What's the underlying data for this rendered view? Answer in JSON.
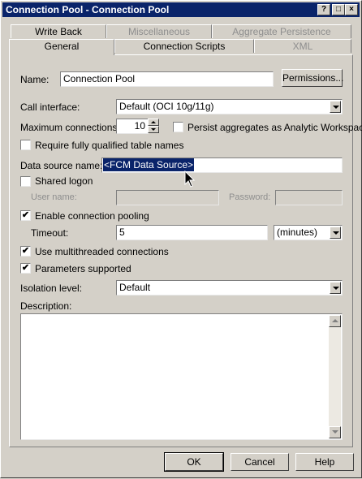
{
  "window": {
    "title": "Connection Pool - Connection Pool",
    "title_buttons": {
      "help": "?",
      "maximize": "□",
      "close": "×"
    }
  },
  "tabs": {
    "row1": [
      {
        "label": "Write Back",
        "enabled": true
      },
      {
        "label": "Miscellaneous",
        "enabled": false
      },
      {
        "label": "Aggregate Persistence",
        "enabled": false
      }
    ],
    "row2": [
      {
        "label": "General",
        "enabled": true,
        "active": true
      },
      {
        "label": "Connection Scripts",
        "enabled": true
      },
      {
        "label": "XML",
        "enabled": false
      }
    ]
  },
  "general": {
    "name_label": "Name:",
    "name_value": "Connection Pool",
    "permissions_button": "Permissions...",
    "call_interface_label": "Call interface:",
    "call_interface_value": "Default (OCI 10g/11g)",
    "max_connections_label": "Maximum connections:",
    "max_connections_value": "10",
    "persist_aggregates_label": "Persist aggregates as Analytic Workspace",
    "persist_aggregates_checked": false,
    "require_qualified_label": "Require fully qualified table names",
    "require_qualified_checked": false,
    "data_source_label": "Data source name:",
    "data_source_value": "<FCM Data Source>",
    "shared_logon_label": "Shared logon",
    "shared_logon_checked": false,
    "user_name_label": "User name:",
    "user_name_value": "",
    "password_label": "Password:",
    "password_value": "",
    "enable_pooling_label": "Enable connection pooling",
    "enable_pooling_checked": true,
    "timeout_label": "Timeout:",
    "timeout_value": "5",
    "timeout_unit": "(minutes)",
    "multithreaded_label": "Use multithreaded connections",
    "multithreaded_checked": true,
    "params_supported_label": "Parameters supported",
    "params_supported_checked": true,
    "isolation_label": "Isolation level:",
    "isolation_value": "Default",
    "description_label": "Description:",
    "description_value": ""
  },
  "footer": {
    "ok": "OK",
    "cancel": "Cancel",
    "help": "Help"
  },
  "colors": {
    "titlebar": "#0a246a",
    "face": "#d4d0c8",
    "selection": "#0a246a"
  },
  "icons": {
    "check": "✔"
  }
}
